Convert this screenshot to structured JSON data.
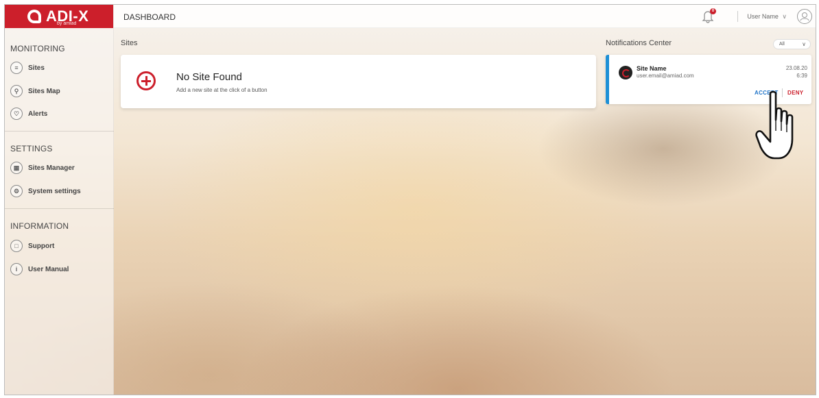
{
  "brand": {
    "name": "ADI-X",
    "sub": "by amiad",
    "color": "#cc1f2b"
  },
  "header": {
    "title": "DASHBOARD",
    "user_name": "User Name",
    "user_chevron": "∨",
    "notification_count": "0"
  },
  "sidebar": {
    "sections": [
      {
        "title": "MONITORING",
        "items": [
          {
            "label": "Sites",
            "icon": "layers-icon"
          },
          {
            "label": "Sites Map",
            "icon": "map-pin-icon"
          },
          {
            "label": "Alerts",
            "icon": "bell-icon"
          }
        ]
      },
      {
        "title": "SETTINGS",
        "items": [
          {
            "label": "Sites Manager",
            "icon": "sites-manager-icon"
          },
          {
            "label": "System settings",
            "icon": "gear-icon"
          }
        ]
      },
      {
        "title": "INFORMATION",
        "items": [
          {
            "label": "Support",
            "icon": "chat-icon"
          },
          {
            "label": "User Manual",
            "icon": "info-icon"
          }
        ]
      }
    ]
  },
  "sites": {
    "label": "Sites",
    "empty_title": "No Site Found",
    "empty_subtitle": "Add a new site at the click of a button"
  },
  "notifications": {
    "label": "Notifications Center",
    "filter_value": "All",
    "filter_chevron": "∨",
    "items": [
      {
        "site_name": "Site Name",
        "email": "user.email@amiad.com",
        "date": "23.08.20",
        "time": "6:39",
        "accept_label": "ACCEPT",
        "deny_label": "DENY",
        "accent": "#1e90d6"
      }
    ]
  }
}
